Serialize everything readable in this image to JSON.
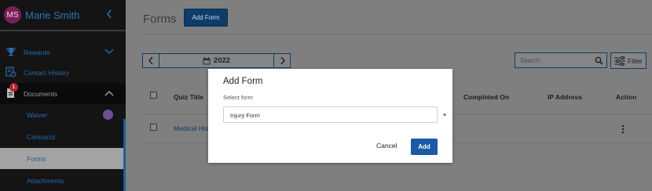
{
  "user": {
    "initials": "MS",
    "name": "Marie Smith"
  },
  "sidebar": {
    "items": [
      {
        "label": "Rewards"
      },
      {
        "label": "Contact History"
      },
      {
        "label": "Documents",
        "badge": "1"
      },
      {
        "label": "Waiver"
      },
      {
        "label": "Contracts"
      },
      {
        "label": "Forms"
      },
      {
        "label": "Attachments"
      }
    ]
  },
  "page": {
    "title": "Forms",
    "add_button": "Add Form"
  },
  "toolbar": {
    "year": "2022",
    "search_placeholder": "Search",
    "filter_label": "Filter"
  },
  "table": {
    "columns": [
      "Quiz Title",
      "Completed On",
      "IP Address",
      "Action"
    ],
    "rows": [
      {
        "title": "Medical Hist"
      }
    ]
  },
  "modal": {
    "title": "Add Form",
    "select_label": "Select form",
    "selected_value": "Injury Form",
    "cancel_label": "Cancel",
    "add_label": "Add"
  },
  "colors": {
    "accent": "#1a5aa6",
    "sidebar_bg": "#141414",
    "badge": "#b3232d"
  }
}
